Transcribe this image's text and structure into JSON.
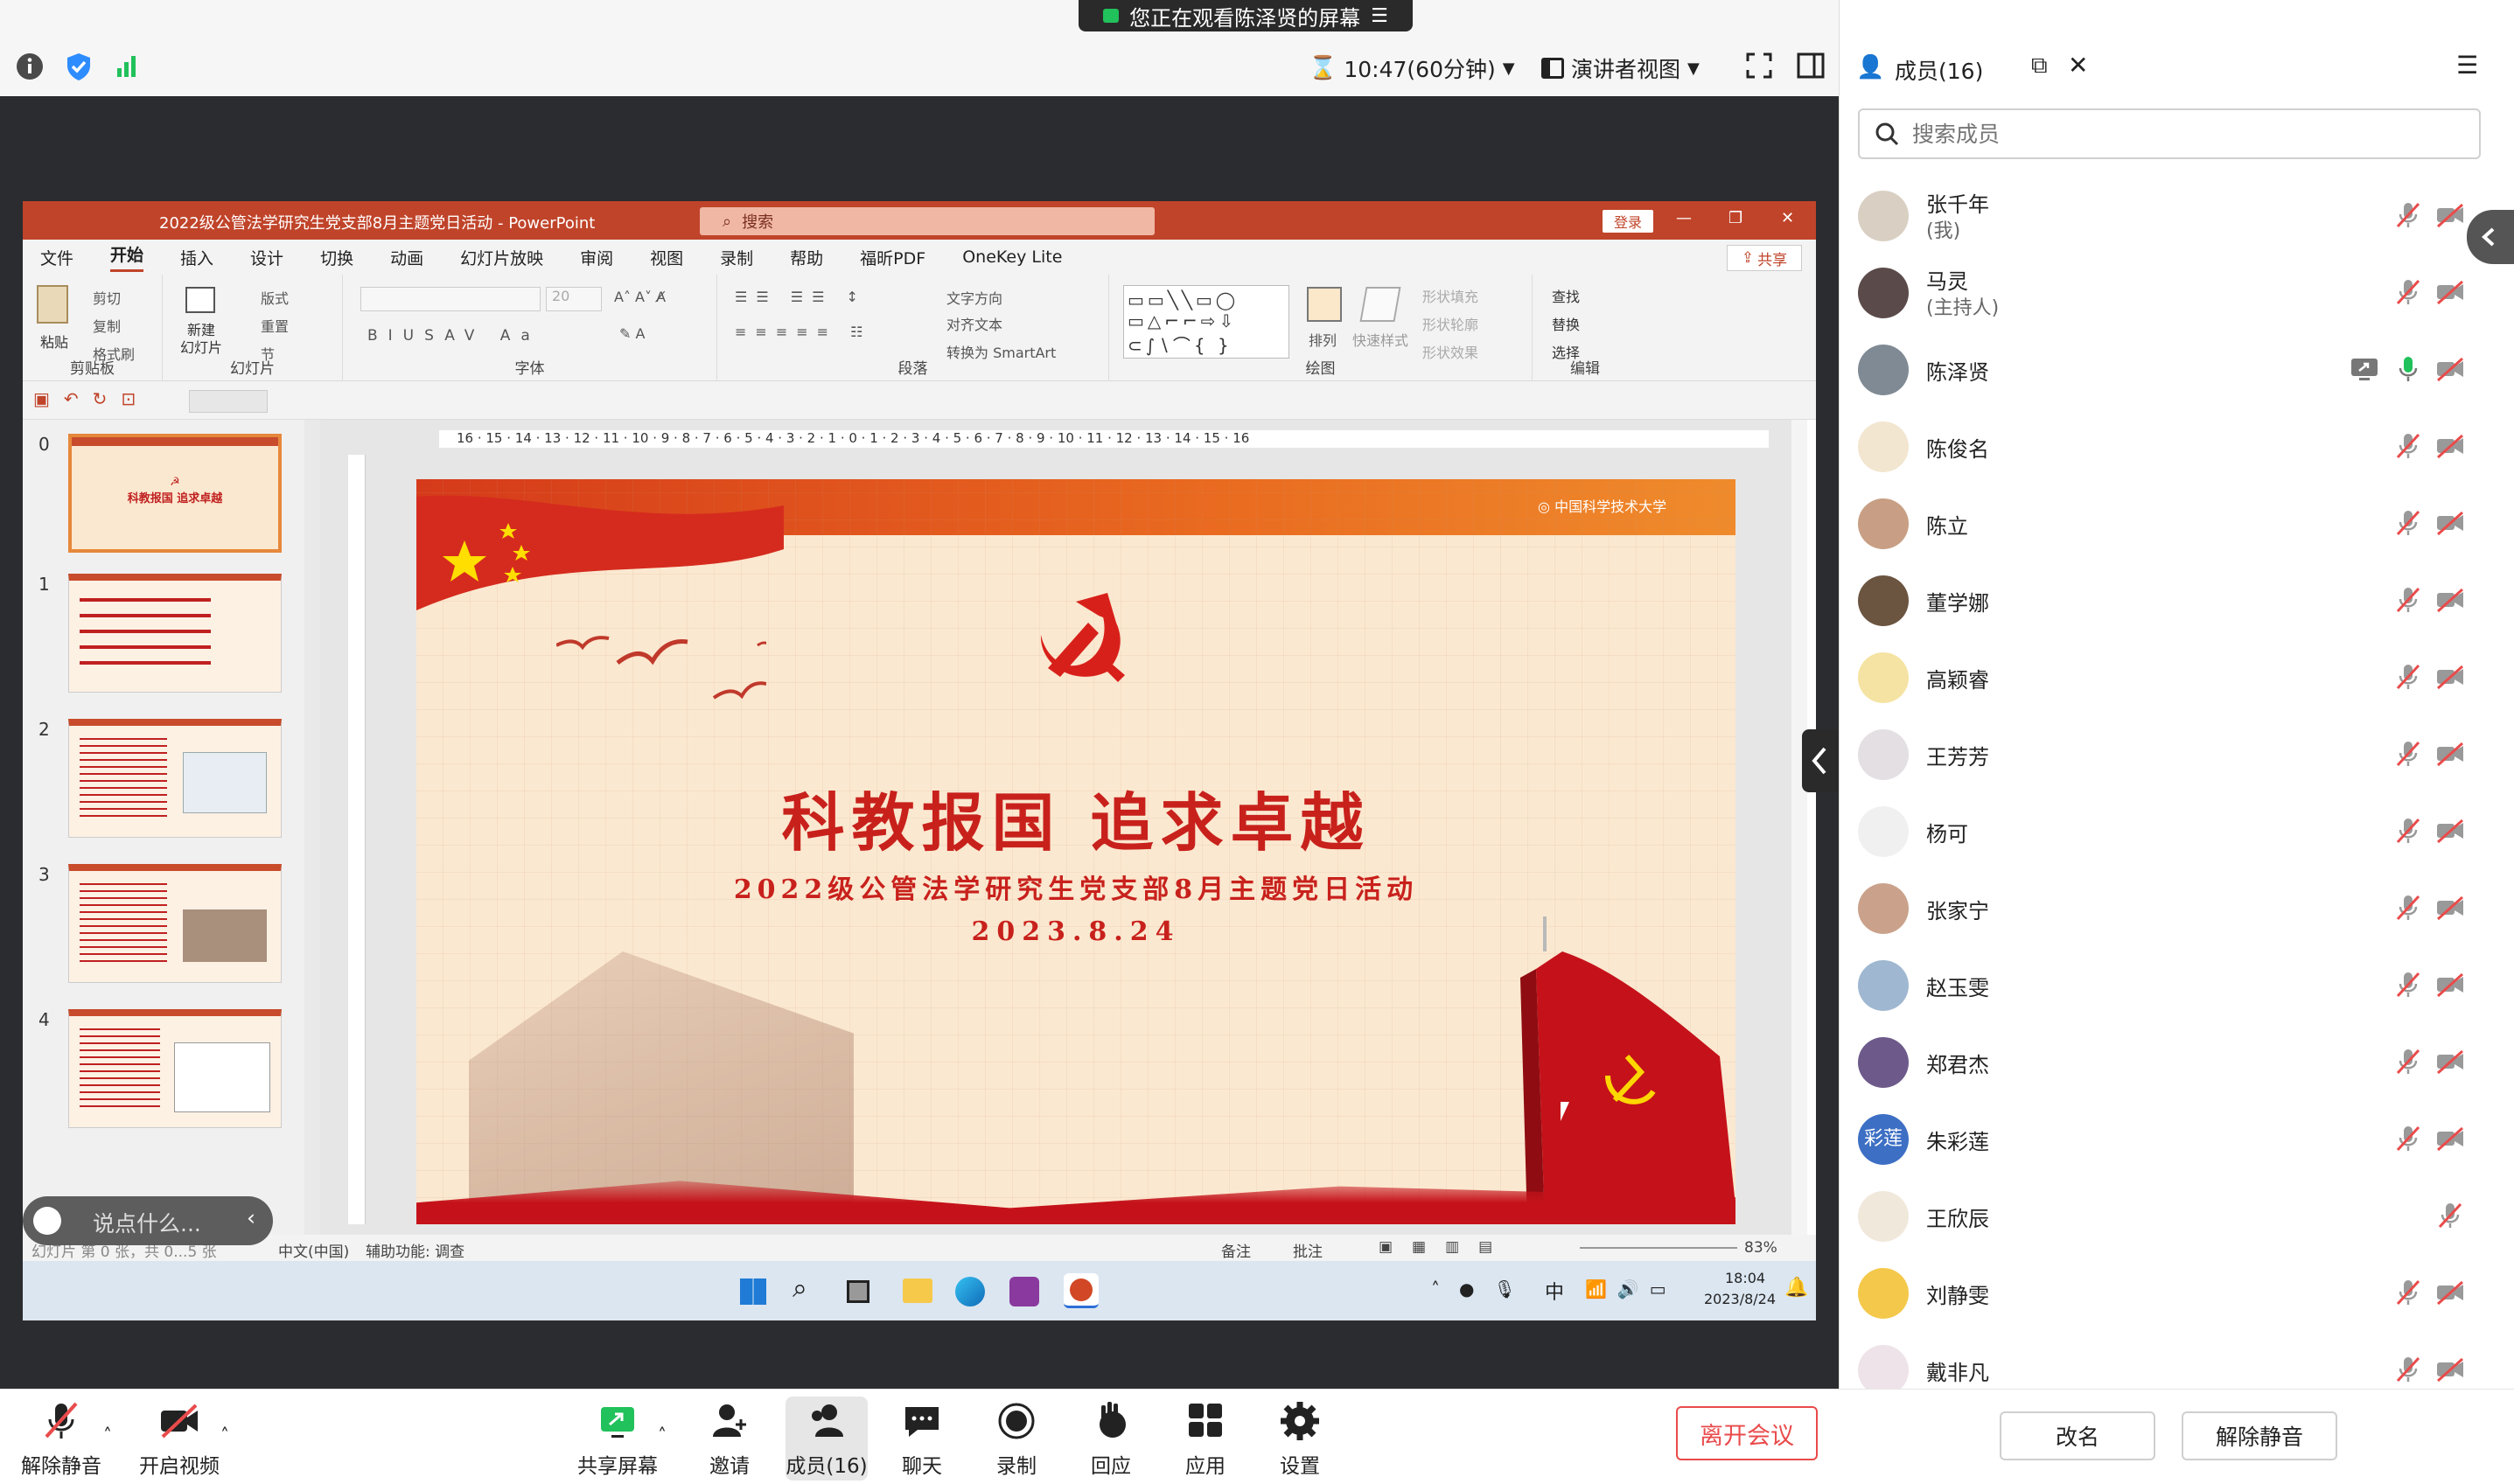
{
  "window": {
    "share_banner": "您正在观看陈泽贤的屏幕",
    "time_remaining": "10:47(60分钟)",
    "view_mode": "演讲者视图"
  },
  "ppt": {
    "title": "2022级公管法学研究生党支部8月主题党日活动 - PowerPoint",
    "search_placeholder": "搜索",
    "login": "登录",
    "share": "共享",
    "menu": [
      "文件",
      "开始",
      "插入",
      "设计",
      "切换",
      "动画",
      "幻灯片放映",
      "审阅",
      "视图",
      "录制",
      "帮助",
      "福昕PDF",
      "OneKey Lite"
    ],
    "ribbon": {
      "clipboard": {
        "label": "剪贴板",
        "paste": "粘贴",
        "cut": "剪切",
        "copy": "复制",
        "format_painter": "格式刷"
      },
      "slides": {
        "label": "幻灯片",
        "new_slide": "新建\n幻灯片",
        "layout": "版式",
        "reset": "重置",
        "section": "节"
      },
      "font": {
        "label": "字体",
        "size": "20"
      },
      "paragraph": {
        "label": "段落",
        "text_direction": "文字方向",
        "align_text": "对齐文本",
        "smartart": "转换为 SmartArt"
      },
      "drawing": {
        "label": "绘图",
        "arrange": "排列",
        "quick_styles": "快速样式",
        "shape_fill": "形状填充",
        "shape_outline": "形状轮廓",
        "shape_effects": "形状效果"
      },
      "editing": {
        "label": "编辑",
        "find": "查找",
        "replace": "替换",
        "select": "选择"
      }
    },
    "ruler": "16 · 15 · 14 · 13 · 12 · 11 · 10 · 9 · 8 · 7 · 6 · 5 · 4 · 3 · 2 · 1 · 0 · 1 · 2 · 3 · 4 · 5 · 6 · 7 · 8 · 9 · 10 · 11 · 12 · 13 · 14 · 15 · 16",
    "thumb_numbers": [
      "0",
      "1",
      "2",
      "3",
      "4"
    ],
    "slide": {
      "title": "科教报国 追求卓越",
      "subtitle": "2022级公管法学研究生党支部8月主题党日活动",
      "date": "2023.8.24",
      "logo": "中国科学技术大学"
    },
    "status": {
      "slide_info": "幻灯片 第 0 张，共 0...5 张",
      "language": "中文(中国)",
      "accessibility": "辅助功能: 调查",
      "notes": "备注",
      "comments": "批注",
      "zoom": "83%"
    },
    "taskbar": {
      "ime": "中",
      "time": "18:04",
      "date": "2023/8/24"
    }
  },
  "chat": {
    "placeholder": "说点什么..."
  },
  "toolbar": {
    "unmute": "解除静音",
    "start_video": "开启视频",
    "share_screen": "共享屏幕",
    "invite": "邀请",
    "members": "成员(16)",
    "chat": "聊天",
    "record": "录制",
    "reactions": "回应",
    "apps": "应用",
    "settings": "设置",
    "leave": "离开会议"
  },
  "panel": {
    "title": "成员(16)",
    "search_placeholder": "搜索成员",
    "rename": "改名",
    "unmute": "解除静音",
    "members": [
      {
        "name": "张千年",
        "role": "(我)",
        "color": "#d9cfc3"
      },
      {
        "name": "马灵",
        "role": "(主持人)",
        "color": "#5b4a4a"
      },
      {
        "name": "陈泽贤",
        "role": "",
        "color": "#7f8a94",
        "sharing": true
      },
      {
        "name": "陈俊名",
        "role": "",
        "color": "#f2e6d0"
      },
      {
        "name": "陈立",
        "role": "",
        "color": "#c89f84"
      },
      {
        "name": "董学娜",
        "role": "",
        "color": "#6b5440"
      },
      {
        "name": "高颖睿",
        "role": "",
        "color": "#f5e3a3"
      },
      {
        "name": "王芳芳",
        "role": "",
        "color": "#e3dfe3"
      },
      {
        "name": "杨可",
        "role": "",
        "color": "#f0f0f0"
      },
      {
        "name": "张家宁",
        "role": "",
        "color": "#caa28b"
      },
      {
        "name": "赵玉雯",
        "role": "",
        "color": "#9fb7d0"
      },
      {
        "name": "郑君杰",
        "role": "",
        "color": "#6d5a8a"
      },
      {
        "name": "朱彩莲",
        "role": "",
        "color": "#3d6fc4",
        "initials": "彩莲"
      },
      {
        "name": "王欣辰",
        "role": "",
        "color": "#f1e8dc"
      },
      {
        "name": "刘静雯",
        "role": "",
        "color": "#f4c84a"
      },
      {
        "name": "戴非凡",
        "role": "",
        "color": "#eee3e8"
      }
    ]
  },
  "colors": {
    "accent": "#2d8cff",
    "ppt_red": "#c0442a",
    "muted_red": "#e94b4b"
  }
}
